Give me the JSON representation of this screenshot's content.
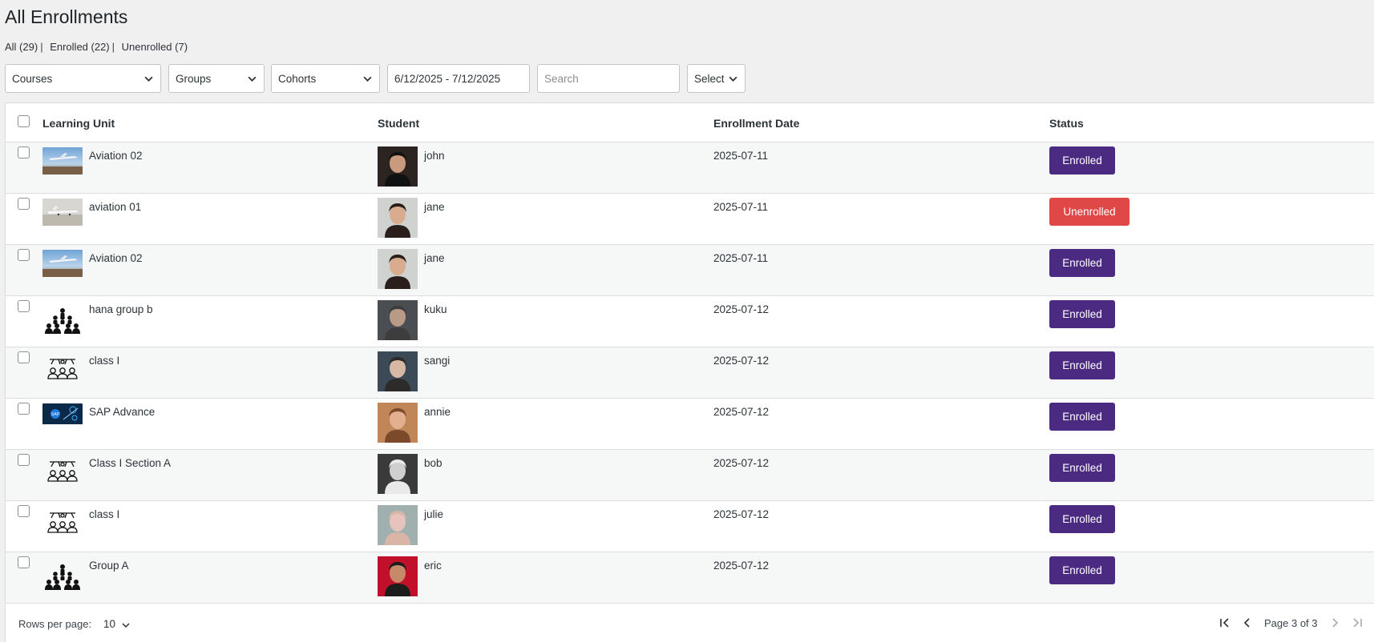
{
  "page": {
    "title": "All Enrollments"
  },
  "views": {
    "all": "All (29)",
    "enrolled": "Enrolled (22)",
    "unenrolled": "Unenrolled (7)",
    "separator": "|"
  },
  "filters": {
    "courses": "Courses",
    "groups": "Groups",
    "cohorts": "Cohorts",
    "date_range": "6/12/2025 - 7/12/2025",
    "search_placeholder": "Search",
    "bulk_select": "Select"
  },
  "table": {
    "headers": {
      "learning_unit": "Learning Unit",
      "student": "Student",
      "enrollment_date": "Enrollment Date",
      "status": "Status"
    },
    "rows": [
      {
        "unit": "Aviation 02",
        "unit_icon": "plane-photo-2",
        "student": "john",
        "avatar": "avatar-john",
        "date": "2025-07-11",
        "status": "Enrolled"
      },
      {
        "unit": "aviation 01",
        "unit_icon": "plane-photo-1",
        "student": "jane",
        "avatar": "avatar-jane",
        "date": "2025-07-11",
        "status": "Unenrolled"
      },
      {
        "unit": "Aviation 02",
        "unit_icon": "plane-photo-2",
        "student": "jane",
        "avatar": "avatar-jane",
        "date": "2025-07-11",
        "status": "Enrolled"
      },
      {
        "unit": "hana group b",
        "unit_icon": "group-icon",
        "student": "kuku",
        "avatar": "avatar-kuku",
        "date": "2025-07-12",
        "status": "Enrolled"
      },
      {
        "unit": "class I",
        "unit_icon": "cohort-icon",
        "student": "sangi",
        "avatar": "avatar-sangi",
        "date": "2025-07-12",
        "status": "Enrolled"
      },
      {
        "unit": "SAP Advance",
        "unit_icon": "sap-photo",
        "student": "annie",
        "avatar": "avatar-annie",
        "date": "2025-07-12",
        "status": "Enrolled"
      },
      {
        "unit": "Class I Section A",
        "unit_icon": "cohort-icon",
        "student": "bob",
        "avatar": "avatar-bob",
        "date": "2025-07-12",
        "status": "Enrolled"
      },
      {
        "unit": "class I",
        "unit_icon": "cohort-icon",
        "student": "julie",
        "avatar": "avatar-julie",
        "date": "2025-07-12",
        "status": "Enrolled"
      },
      {
        "unit": "Group A",
        "unit_icon": "group-icon",
        "student": "eric",
        "avatar": "avatar-eric",
        "date": "2025-07-12",
        "status": "Enrolled"
      }
    ]
  },
  "footer": {
    "rows_per_page_label": "Rows per page:",
    "rows_per_page_value": "10",
    "page_text": "Page 3 of 3"
  },
  "colors": {
    "enrolled": "#4b2b82",
    "unenrolled": "#e04848"
  }
}
